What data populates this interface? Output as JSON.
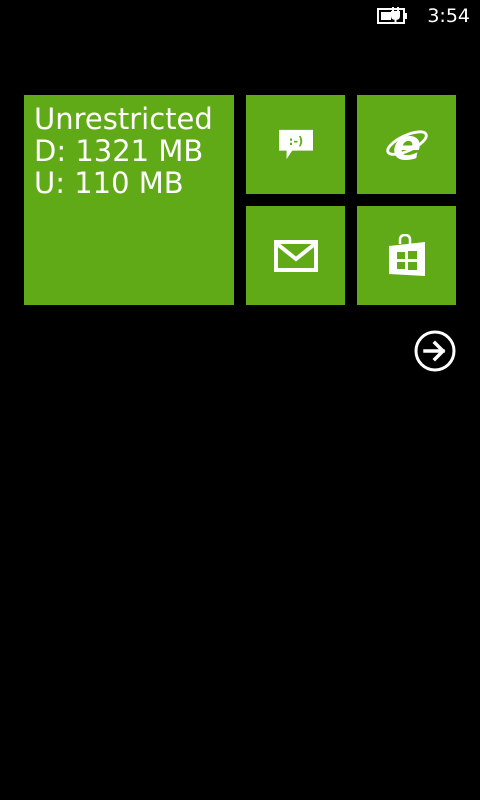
{
  "status_bar": {
    "time": "3:54",
    "battery_icon": "battery-charging-icon"
  },
  "tiles": {
    "data_usage": {
      "line1": "Unrestricted",
      "line2": "D: 1321 MB",
      "line3": "U: 110 MB"
    },
    "messaging": {
      "icon": "messaging-icon"
    },
    "internet_explorer": {
      "icon": "internet-explorer-icon"
    },
    "mail": {
      "icon": "mail-icon"
    },
    "store": {
      "icon": "store-icon"
    }
  },
  "navigation": {
    "app_list_icon": "arrow-right-circle-icon"
  },
  "colors": {
    "accent": "#60a917",
    "background": "#000000",
    "foreground": "#ffffff"
  }
}
